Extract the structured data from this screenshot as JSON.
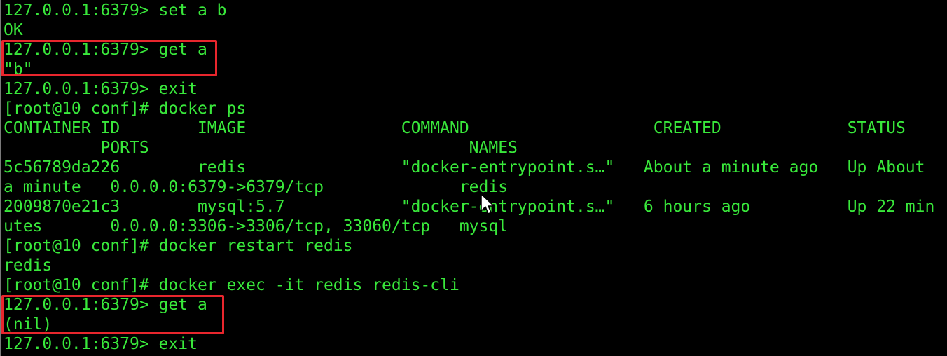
{
  "terminal": {
    "text_color": "#39e83b",
    "background": "#000000",
    "highlight_color": "#e8262d",
    "lines": [
      "127.0.0.1:6379> set a b",
      "OK",
      "127.0.0.1:6379> get a",
      "\"b\"",
      "127.0.0.1:6379> exit",
      "[root@10 conf]# docker ps",
      "CONTAINER ID        IMAGE                COMMAND                   CREATED             STATUS",
      "          PORTS                                 NAMES",
      "5c56789da226        redis                \"docker-entrypoint.s…\"   About a minute ago   Up About",
      "a minute   0.0.0.0:6379->6379/tcp              redis",
      "2009870e21c3        mysql:5.7            \"docker-entrypoint.s…\"   6 hours ago          Up 22 min",
      "utes       0.0.0.0:3306->3306/tcp, 33060/tcp   mysql",
      "[root@10 conf]# docker restart redis",
      "redis",
      "[root@10 conf]# docker exec -it redis redis-cli",
      "127.0.0.1:6379> get a",
      "(nil)",
      "127.0.0.1:6379> exit"
    ]
  },
  "cursor_icon": "mouse-pointer-icon"
}
